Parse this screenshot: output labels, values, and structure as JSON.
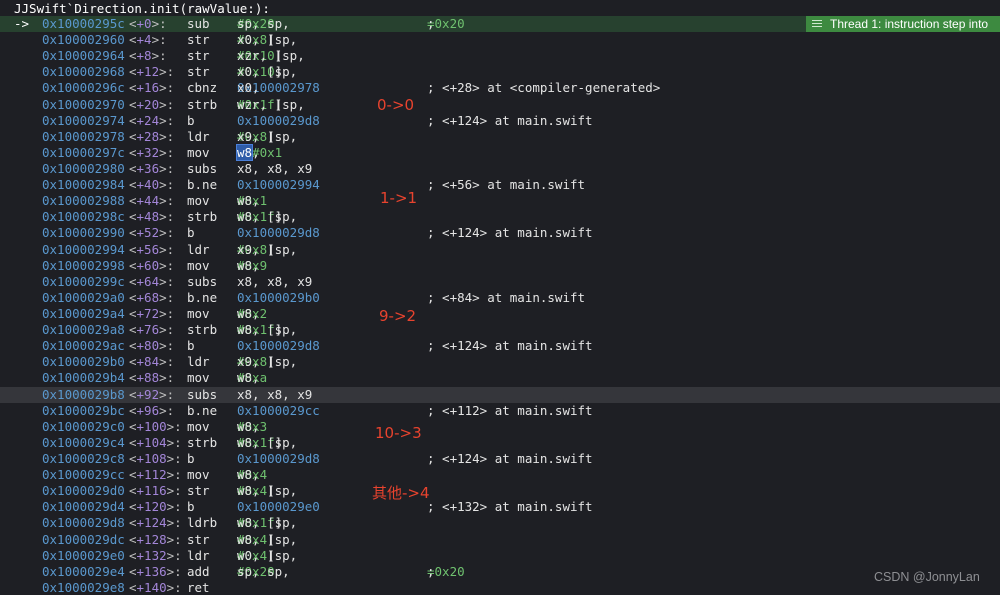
{
  "title": "JJSwift`Direction.init(rawValue:):",
  "current_marker": "->",
  "thread_badge": "Thread 1: instruction step into",
  "watermark": "CSDN @JonnyLan",
  "colors": {
    "background": "#1e1f24",
    "address": "#5a98ce",
    "offset_number": "#a386d8",
    "immediate": "#6fc16f",
    "annotation": "#e8432e",
    "current_line": "#27412f",
    "badge": "#3d8a40"
  },
  "annotations": [
    "0->0",
    "1->1",
    "9->2",
    "10->3",
    "其他->4"
  ],
  "lines": [
    {
      "addr": "0x10000295c",
      "off": "+0",
      "mn": "sub",
      "ops": [
        [
          "sp, sp, ",
          ""
        ],
        [
          "#0x20",
          "imm"
        ]
      ],
      "cmt": [
        [
          "; ",
          ""
        ],
        [
          "=0x20",
          "eq"
        ]
      ]
    },
    {
      "addr": "0x100002960",
      "off": "+4",
      "mn": "str",
      "ops": [
        [
          "x0, [sp, ",
          ""
        ],
        [
          "#0x8",
          "imm"
        ],
        [
          "]",
          ""
        ]
      ],
      "cmt": []
    },
    {
      "addr": "0x100002964",
      "off": "+8",
      "mn": "str",
      "ops": [
        [
          "xzr, [sp, ",
          ""
        ],
        [
          "#0x10",
          "imm"
        ],
        [
          "]",
          ""
        ]
      ],
      "cmt": []
    },
    {
      "addr": "0x100002968",
      "off": "+12",
      "mn": "str",
      "ops": [
        [
          "x0, [sp, ",
          ""
        ],
        [
          "#0x10",
          "imm"
        ],
        [
          "]",
          ""
        ]
      ],
      "cmt": []
    },
    {
      "addr": "0x10000296c",
      "off": "+16",
      "mn": "cbnz",
      "ops": [
        [
          "x0, ",
          ""
        ],
        [
          "0x100002978",
          "tgt"
        ]
      ],
      "cmt": [
        [
          "; <+28> at <compiler-generated>",
          ""
        ]
      ]
    },
    {
      "addr": "0x100002970",
      "off": "+20",
      "mn": "strb",
      "ops": [
        [
          "wzr, [sp, ",
          ""
        ],
        [
          "#0x1f",
          "imm"
        ],
        [
          "]",
          ""
        ]
      ],
      "cmt": []
    },
    {
      "addr": "0x100002974",
      "off": "+24",
      "mn": "b",
      "ops": [
        [
          "0x1000029d8",
          "tgt"
        ]
      ],
      "cmt": [
        [
          "; <+124> at main.swift",
          ""
        ]
      ]
    },
    {
      "addr": "0x100002978",
      "off": "+28",
      "mn": "ldr",
      "ops": [
        [
          "x9, [sp, ",
          ""
        ],
        [
          "#0x8",
          "imm"
        ],
        [
          "]",
          ""
        ]
      ],
      "cmt": []
    },
    {
      "addr": "0x10000297c",
      "off": "+32",
      "mn": "mov",
      "ops": [
        [
          "w8",
          "sel"
        ],
        [
          ", ",
          ""
        ],
        [
          "#0x1",
          "imm"
        ]
      ],
      "cmt": []
    },
    {
      "addr": "0x100002980",
      "off": "+36",
      "mn": "subs",
      "ops": [
        [
          "x8, x8, x9",
          ""
        ]
      ],
      "cmt": []
    },
    {
      "addr": "0x100002984",
      "off": "+40",
      "mn": "b.ne",
      "ops": [
        [
          "0x100002994",
          "tgt"
        ]
      ],
      "cmt": [
        [
          "; <+56> at main.swift",
          ""
        ]
      ]
    },
    {
      "addr": "0x100002988",
      "off": "+44",
      "mn": "mov",
      "ops": [
        [
          "w8, ",
          ""
        ],
        [
          "#0x1",
          "imm"
        ]
      ],
      "cmt": []
    },
    {
      "addr": "0x10000298c",
      "off": "+48",
      "mn": "strb",
      "ops": [
        [
          "w8, [sp, ",
          ""
        ],
        [
          "#0x1f",
          "imm"
        ],
        [
          "]",
          ""
        ]
      ],
      "cmt": []
    },
    {
      "addr": "0x100002990",
      "off": "+52",
      "mn": "b",
      "ops": [
        [
          "0x1000029d8",
          "tgt"
        ]
      ],
      "cmt": [
        [
          "; <+124> at main.swift",
          ""
        ]
      ]
    },
    {
      "addr": "0x100002994",
      "off": "+56",
      "mn": "ldr",
      "ops": [
        [
          "x9, [sp, ",
          ""
        ],
        [
          "#0x8",
          "imm"
        ],
        [
          "]",
          ""
        ]
      ],
      "cmt": []
    },
    {
      "addr": "0x100002998",
      "off": "+60",
      "mn": "mov",
      "ops": [
        [
          "w8, ",
          ""
        ],
        [
          "#0x9",
          "imm"
        ]
      ],
      "cmt": []
    },
    {
      "addr": "0x10000299c",
      "off": "+64",
      "mn": "subs",
      "ops": [
        [
          "x8, x8, x9",
          ""
        ]
      ],
      "cmt": []
    },
    {
      "addr": "0x1000029a0",
      "off": "+68",
      "mn": "b.ne",
      "ops": [
        [
          "0x1000029b0",
          "tgt"
        ]
      ],
      "cmt": [
        [
          "; <+84> at main.swift",
          ""
        ]
      ]
    },
    {
      "addr": "0x1000029a4",
      "off": "+72",
      "mn": "mov",
      "ops": [
        [
          "w8, ",
          ""
        ],
        [
          "#0x2",
          "imm"
        ]
      ],
      "cmt": []
    },
    {
      "addr": "0x1000029a8",
      "off": "+76",
      "mn": "strb",
      "ops": [
        [
          "w8, [sp, ",
          ""
        ],
        [
          "#0x1f",
          "imm"
        ],
        [
          "]",
          ""
        ]
      ],
      "cmt": []
    },
    {
      "addr": "0x1000029ac",
      "off": "+80",
      "mn": "b",
      "ops": [
        [
          "0x1000029d8",
          "tgt"
        ]
      ],
      "cmt": [
        [
          "; <+124> at main.swift",
          ""
        ]
      ]
    },
    {
      "addr": "0x1000029b0",
      "off": "+84",
      "mn": "ldr",
      "ops": [
        [
          "x9, [sp, ",
          ""
        ],
        [
          "#0x8",
          "imm"
        ],
        [
          "]",
          ""
        ]
      ],
      "cmt": []
    },
    {
      "addr": "0x1000029b4",
      "off": "+88",
      "mn": "mov",
      "ops": [
        [
          "w8, ",
          ""
        ],
        [
          "#0xa",
          "imm"
        ]
      ],
      "cmt": []
    },
    {
      "addr": "0x1000029b8",
      "off": "+92",
      "mn": "subs",
      "ops": [
        [
          "x8, x8, x9",
          ""
        ]
      ],
      "cmt": []
    },
    {
      "addr": "0x1000029bc",
      "off": "+96",
      "mn": "b.ne",
      "ops": [
        [
          "0x1000029cc",
          "tgt"
        ]
      ],
      "cmt": [
        [
          "; <+112> at main.swift",
          ""
        ]
      ]
    },
    {
      "addr": "0x1000029c0",
      "off": "+100",
      "mn": "mov",
      "ops": [
        [
          "w8, ",
          ""
        ],
        [
          "#0x3",
          "imm"
        ]
      ],
      "cmt": []
    },
    {
      "addr": "0x1000029c4",
      "off": "+104",
      "mn": "strb",
      "ops": [
        [
          "w8, [sp, ",
          ""
        ],
        [
          "#0x1f",
          "imm"
        ],
        [
          "]",
          ""
        ]
      ],
      "cmt": []
    },
    {
      "addr": "0x1000029c8",
      "off": "+108",
      "mn": "b",
      "ops": [
        [
          "0x1000029d8",
          "tgt"
        ]
      ],
      "cmt": [
        [
          "; <+124> at main.swift",
          ""
        ]
      ]
    },
    {
      "addr": "0x1000029cc",
      "off": "+112",
      "mn": "mov",
      "ops": [
        [
          "w8, ",
          ""
        ],
        [
          "#0x4",
          "imm"
        ]
      ],
      "cmt": []
    },
    {
      "addr": "0x1000029d0",
      "off": "+116",
      "mn": "str",
      "ops": [
        [
          "w8, [sp, ",
          ""
        ],
        [
          "#0x4",
          "imm"
        ],
        [
          "]",
          ""
        ]
      ],
      "cmt": []
    },
    {
      "addr": "0x1000029d4",
      "off": "+120",
      "mn": "b",
      "ops": [
        [
          "0x1000029e0",
          "tgt"
        ]
      ],
      "cmt": [
        [
          "; <+132> at main.swift",
          ""
        ]
      ]
    },
    {
      "addr": "0x1000029d8",
      "off": "+124",
      "mn": "ldrb",
      "ops": [
        [
          "w8, [sp, ",
          ""
        ],
        [
          "#0x1f",
          "imm"
        ],
        [
          "]",
          ""
        ]
      ],
      "cmt": []
    },
    {
      "addr": "0x1000029dc",
      "off": "+128",
      "mn": "str",
      "ops": [
        [
          "w8, [sp, ",
          ""
        ],
        [
          "#0x4",
          "imm"
        ],
        [
          "]",
          ""
        ]
      ],
      "cmt": []
    },
    {
      "addr": "0x1000029e0",
      "off": "+132",
      "mn": "ldr",
      "ops": [
        [
          "w0, [sp, ",
          ""
        ],
        [
          "#0x4",
          "imm"
        ],
        [
          "]",
          ""
        ]
      ],
      "cmt": []
    },
    {
      "addr": "0x1000029e4",
      "off": "+136",
      "mn": "add",
      "ops": [
        [
          "sp, sp, ",
          ""
        ],
        [
          "#0x20",
          "imm"
        ]
      ],
      "cmt": [
        [
          "; ",
          ""
        ],
        [
          "=0x20",
          "eq"
        ]
      ]
    },
    {
      "addr": "0x1000029e8",
      "off": "+140",
      "mn": "ret",
      "ops": [],
      "cmt": []
    }
  ]
}
